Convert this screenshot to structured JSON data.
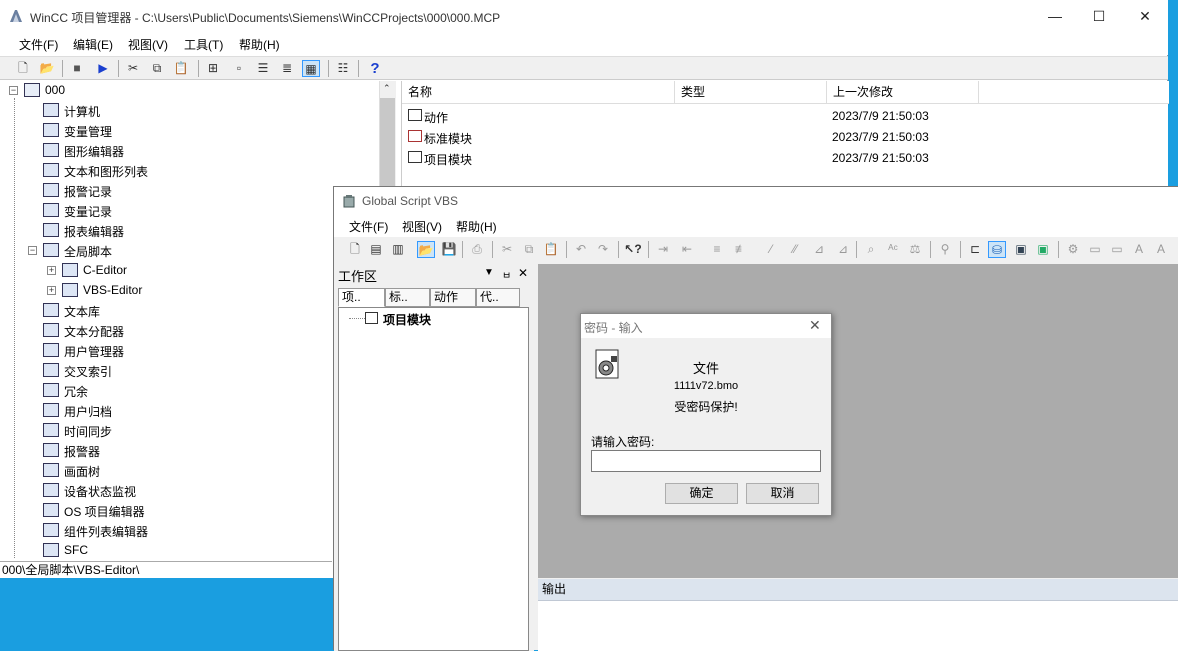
{
  "main_window": {
    "title": "WinCC 项目管理器 - C:\\Users\\Public\\Documents\\Siemens\\WinCCProjects\\000\\000.MCP",
    "controls": {
      "minimize": "—",
      "maximize": "☐",
      "close": "✕"
    },
    "menu": [
      "文件(F)",
      "编辑(E)",
      "视图(V)",
      "工具(T)",
      "帮助(H)"
    ],
    "tree": {
      "root": "000",
      "items": [
        {
          "label": "计算机",
          "level": 1
        },
        {
          "label": "变量管理",
          "level": 1
        },
        {
          "label": "图形编辑器",
          "level": 1
        },
        {
          "label": "文本和图形列表",
          "level": 1
        },
        {
          "label": "报警记录",
          "level": 1
        },
        {
          "label": "变量记录",
          "level": 1
        },
        {
          "label": "报表编辑器",
          "level": 1
        },
        {
          "label": "全局脚本",
          "level": 1
        },
        {
          "label": "C-Editor",
          "level": 2
        },
        {
          "label": "VBS-Editor",
          "level": 2
        },
        {
          "label": "文本库",
          "level": 1
        },
        {
          "label": "文本分配器",
          "level": 1
        },
        {
          "label": "用户管理器",
          "level": 1
        },
        {
          "label": "交叉索引",
          "level": 1
        },
        {
          "label": "冗余",
          "level": 1
        },
        {
          "label": "用户归档",
          "level": 1
        },
        {
          "label": "时间同步",
          "level": 1
        },
        {
          "label": "报警器",
          "level": 1
        },
        {
          "label": "画面树",
          "level": 1
        },
        {
          "label": "设备状态监视",
          "level": 1
        },
        {
          "label": "OS 项目编辑器",
          "level": 1
        },
        {
          "label": "组件列表编辑器",
          "level": 1
        },
        {
          "label": "SFC",
          "level": 1
        }
      ]
    },
    "status_path": "000\\全局脚本\\VBS-Editor\\",
    "list": {
      "columns": [
        "名称",
        "类型",
        "上一次修改"
      ],
      "rows": [
        {
          "name": "动作",
          "type": "",
          "modified": "2023/7/9 21:50:03"
        },
        {
          "name": "标准模块",
          "type": "",
          "modified": "2023/7/9 21:50:03"
        },
        {
          "name": "项目模块",
          "type": "",
          "modified": "2023/7/9 21:50:03"
        }
      ]
    }
  },
  "gs_window": {
    "title": "Global Script VBS",
    "menu": [
      "文件(F)",
      "视图(V)",
      "帮助(H)"
    ],
    "workspace": {
      "title": "工作区",
      "controls": {
        "dropdown": "▼",
        "pin": "ㅂ",
        "close": "✕"
      },
      "tabs": [
        "项..",
        "标..",
        "动作",
        "代.."
      ],
      "tree_item": "项目模块"
    },
    "output_title": "输出"
  },
  "dialog": {
    "title": "密码 - 输入",
    "close": "✕",
    "line1": "文件",
    "line2": "1111v72.bmo",
    "line3": "受密码保护!",
    "prompt": "请输入密码:",
    "password_value": "",
    "ok": "确定",
    "cancel": "取消"
  }
}
